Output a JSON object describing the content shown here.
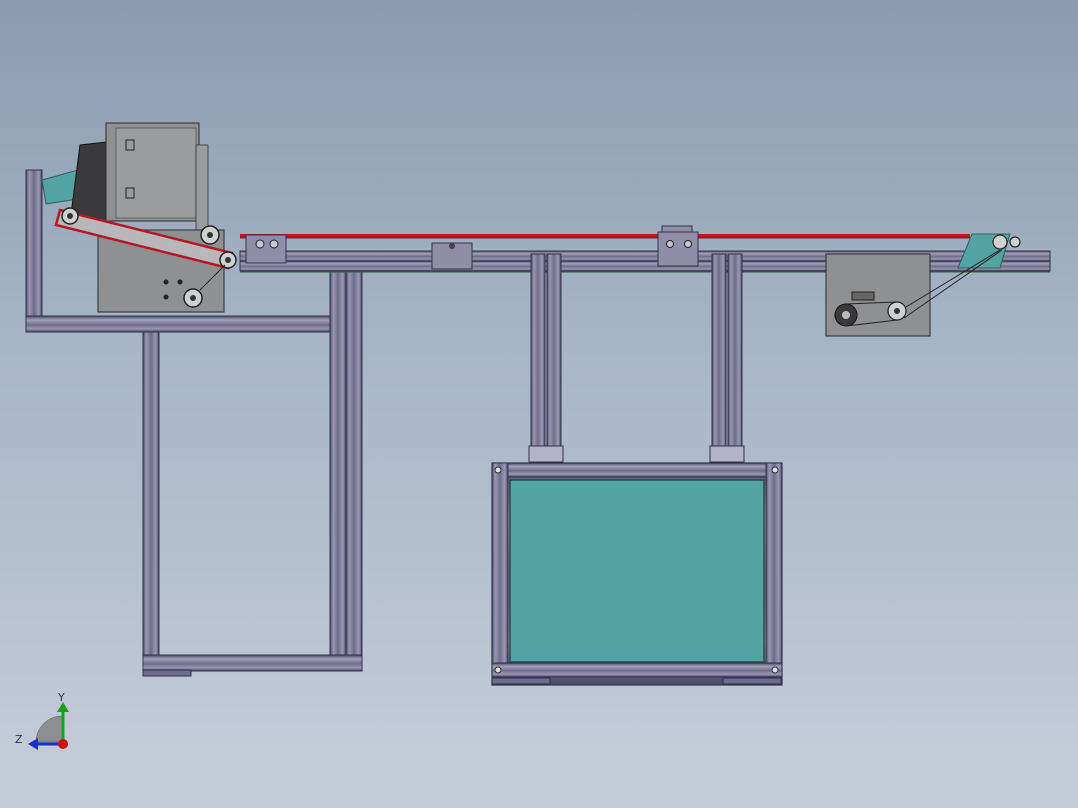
{
  "viewport": {
    "background_top": "#8a9bb2",
    "background_bottom": "#c6ced9"
  },
  "colors": {
    "profile_fill": "#7d7a98",
    "profile_dark": "#3d3b55",
    "profile_light": "#b4b2c8",
    "belt_red": "#c0141c",
    "teal_panel": "#52a3a3",
    "plate_gray": "#8e9092",
    "dark_hopper": "#3a3a3c"
  },
  "triad": {
    "y_label": "Y",
    "z_label": "Z",
    "y_color": "#1aa01a",
    "z_color": "#1a2fd0",
    "origin_color": "#d01010",
    "icon": "axis-triad-icon"
  }
}
